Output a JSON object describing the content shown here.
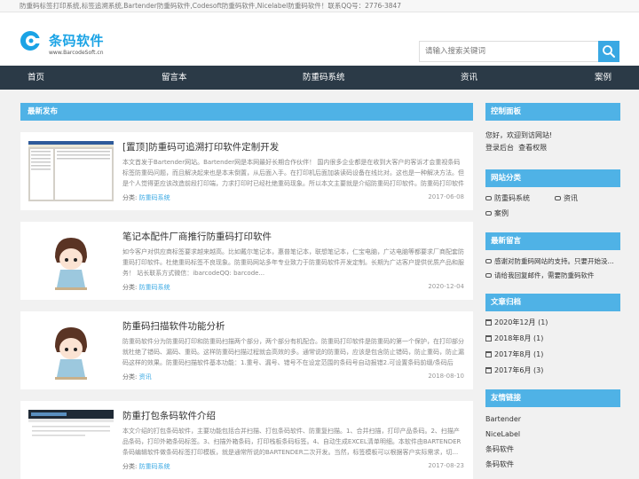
{
  "topbar": {
    "text": "防重码标签打印系统,标签追溯系统,Bartender防重码软件,Codesoft防重码软件,Nicelabel防重码软件！联系QQ号：2776-3847"
  },
  "logo": {
    "name": "条码软件",
    "sub": "www.BarcodeSoft.cn"
  },
  "search": {
    "placeholder": "请输入搜索关键词"
  },
  "nav": [
    "首页",
    "留言本",
    "防重码系统",
    "资讯",
    "案例"
  ],
  "main": {
    "heading": "最新发布",
    "posts": [
      {
        "title": "[置顶]防重码可追溯打印软件定制开发",
        "excerpt": "本文首发于Bartender网站。Bartender网是本网最好长期合作伙伴！ 国内很多企业都是在收到大客户的客诉才会重视条码标签防重码问题，而且解决起来也是本末倒置，从后面入手。在打印机后面加装读码设备在线比对。这也是一种解决方法。但是个人觉得更应该改造前段打印端，力求打印时已经杜绝重码现象。所以本文主要就是介绍防重码打印软件。防重码打印软件需...",
        "category_label": "分类:",
        "category": "防重码系统",
        "date": "2017-06-08"
      },
      {
        "title": "笔记本配件厂商推行防重码打印软件",
        "excerpt": "如今客户对供应商标签要求越来越高。比如戴尔笔记本，惠普笔记本，联想笔记本，仁宝电脑，广达电脑等都要求厂商配套防重码打印软件。杜绝重码标签不良现象。防重码网站多年专业致力于防重码软件开发定制。长期为广达客户提供优质产品和服务！ 站长联系方式微信：ibarcodeQQ: barcode...",
        "category_label": "分类:",
        "category": "防重码系统",
        "date": "2020-12-04"
      },
      {
        "title": "防重码扫描软件功能分析",
        "excerpt": "防重码软件分为防重码打印和防重码扫描两个部分，两个部分有机配合。防重码打印软件是防重码的第一个保护，在打印部分就杜绝了错码、漏码、重码。这样防重码扫描过程就会高效的多。通常说的防重码，应该是包含防止错码，防止重码，防止漏码这样的效果。防重码扫描软件基本功能：1.重号、漏号、错号不在设定范围的条码号自动报错2.可设置条码前缀/条码后缀...",
        "category_label": "分类:",
        "category": "资讯",
        "date": "2018-08-10"
      },
      {
        "title": "防重打包条码软件介绍",
        "excerpt": "本文介绍的打包条码软件，主要功能包括合并扫描、打包条码软件、防重复扫描。1、合并扫描，打印产品条码。2、扫描产品条码，打印外箱条码标签。3、扫描外箱条码，打印栈板条码标签。4、自动生成EXCEL清单明细。本软件由BARTENDER条码编辑软件做条码标签打印模板，就是通常所说的BARTENDER二次开发。当然，标签模板可以根据客户实际需求，切...",
        "category_label": "分类:",
        "category": "防重码系统",
        "date": "2017-08-23"
      }
    ]
  },
  "sidebar": {
    "control": {
      "heading": "控制面板",
      "welcome": "您好，欢迎到访网站!",
      "login": "登录后台",
      "permission": "查看权限"
    },
    "categories": {
      "heading": "网站分类",
      "items": [
        "防重码系统",
        "资讯",
        "案例"
      ]
    },
    "messages": {
      "heading": "最新留言",
      "items": [
        "感谢对防重码网站的支持。只要开始没...",
        "请给我回复邮件，需要防重码软件"
      ]
    },
    "archives": {
      "heading": "文章归档",
      "items": [
        "2020年12月 (1)",
        "2018年8月 (1)",
        "2017年8月 (1)",
        "2017年6月 (3)"
      ]
    },
    "links": {
      "heading": "友情链接",
      "items": [
        "Bartender",
        "NiceLabel",
        "条码软件",
        "条码软件"
      ]
    }
  }
}
